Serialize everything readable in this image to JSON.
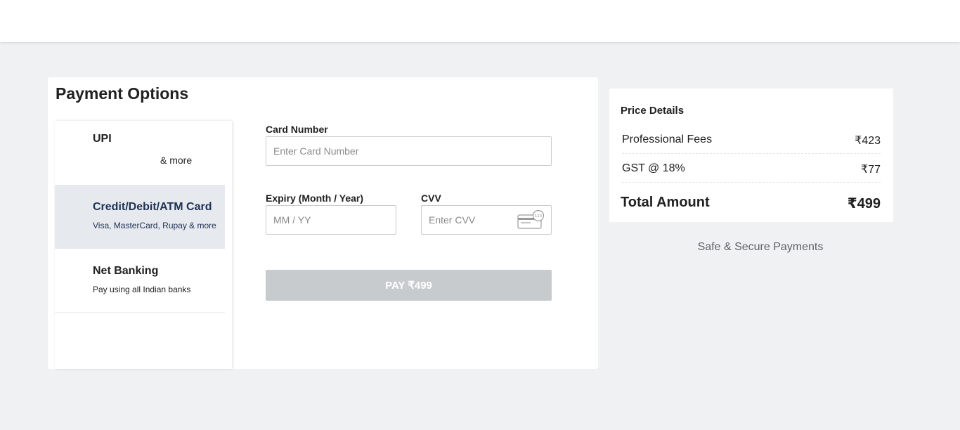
{
  "payment": {
    "title": "Payment Options",
    "methods": [
      {
        "title": "UPI",
        "subtitle": "& more"
      },
      {
        "title": "Credit/Debit/ATM Card",
        "subtitle": "Visa, MasterCard, Rupay & more"
      },
      {
        "title": "Net Banking",
        "subtitle": "Pay using all Indian banks"
      }
    ],
    "selected_method": "Credit/Debit/ATM Card",
    "card_number": {
      "label": "Card Number",
      "placeholder": "Enter Card Number",
      "value": ""
    },
    "expiry": {
      "label": "Expiry (Month / Year)",
      "placeholder": "MM / YY",
      "value": ""
    },
    "cvv": {
      "label": "CVV",
      "placeholder": "Enter CVV",
      "value": "",
      "icon": "card-cvv-icon"
    },
    "pay_button": "PAY ₹499"
  },
  "price": {
    "title": "Price Details",
    "rows": [
      {
        "label": "Professional Fees",
        "value": "₹423"
      },
      {
        "label": "GST @ 18%",
        "value": "₹77"
      }
    ],
    "total_label": "Total Amount",
    "total_value": "₹499",
    "secure_text": "Safe & Secure Payments"
  },
  "colors": {
    "background": "#f0f1f3",
    "selected_method_bg": "#e6e9ee",
    "pay_button_disabled": "#c8cbce"
  }
}
